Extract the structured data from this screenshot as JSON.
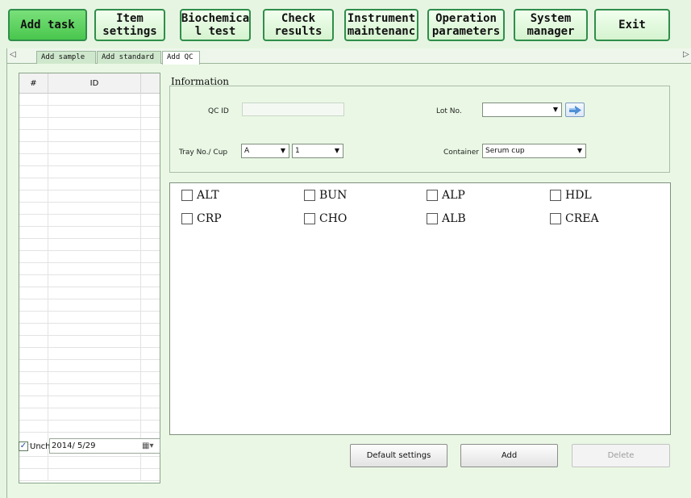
{
  "toolbar": {
    "buttons": [
      {
        "label": "Add task"
      },
      {
        "label": "Item\nsettings"
      },
      {
        "label": "Biochemica\nl test"
      },
      {
        "label": "Check\nresults"
      },
      {
        "label": "Instrument\nmaintenanc"
      },
      {
        "label": "Operation\nparameters"
      },
      {
        "label": "System\nmanager"
      },
      {
        "label": "Exit"
      }
    ],
    "active_color": "#4ccc50",
    "border_color": "#2f8e4b"
  },
  "tabs": {
    "left_arrow": "◁",
    "right_arrow": "▷",
    "items": [
      {
        "label": "Add sample"
      },
      {
        "label": "Add standard"
      },
      {
        "label": "Add QC"
      }
    ],
    "selected": "Add QC"
  },
  "list": {
    "columns": [
      "#",
      "ID"
    ]
  },
  "unch": {
    "checked": true,
    "check_glyph": "✓",
    "label": "Unch",
    "date": "2014/ 5/29",
    "date_icon": "▦▾"
  },
  "information": {
    "title": "Information",
    "qc_id_label": "QC ID",
    "qc_id_value": "",
    "lot_label": "Lot No.",
    "lot_value": "",
    "tray_label": "Tray No./ Cup",
    "tray_value": "A",
    "cup_value": "1",
    "container_label": "Container",
    "container_value": "Serum cup",
    "dropdown_glyph": "▼"
  },
  "items": [
    {
      "label": "ALT"
    },
    {
      "label": "BUN"
    },
    {
      "label": "ALP"
    },
    {
      "label": "HDL"
    },
    {
      "label": "CRP"
    },
    {
      "label": "CHO"
    },
    {
      "label": "ALB"
    },
    {
      "label": "CREA"
    }
  ],
  "actions": {
    "default_label": "Default settings",
    "add_label": "Add",
    "delete_label": "Delete"
  }
}
